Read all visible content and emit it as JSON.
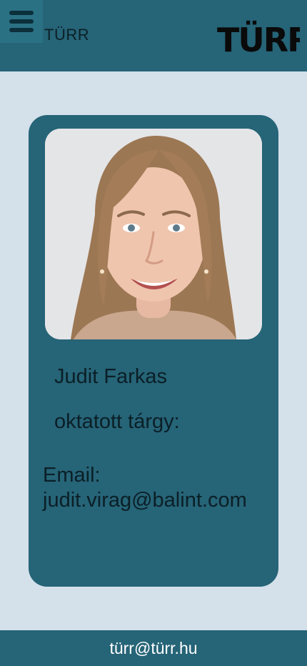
{
  "header": {
    "brand_name": "TÜRR",
    "logo_text": "TÜRR",
    "menu_icon": "hamburger-menu-icon"
  },
  "card": {
    "photo": "portrait photo of smiling woman with long light-brown hair",
    "name": "Judit Farkas",
    "subject_label": "oktatott tárgy:",
    "email_label": "Email:",
    "email_value": "judit.virag@balint.com"
  },
  "footer": {
    "email": "türr@türr.hu"
  },
  "colors": {
    "page_background": "#d4e0ea",
    "header_footer": "#266477",
    "card": "#266477",
    "menu_button": "#2b7184",
    "text_dark": "#0b1f27",
    "footer_text": "#ffffff"
  }
}
